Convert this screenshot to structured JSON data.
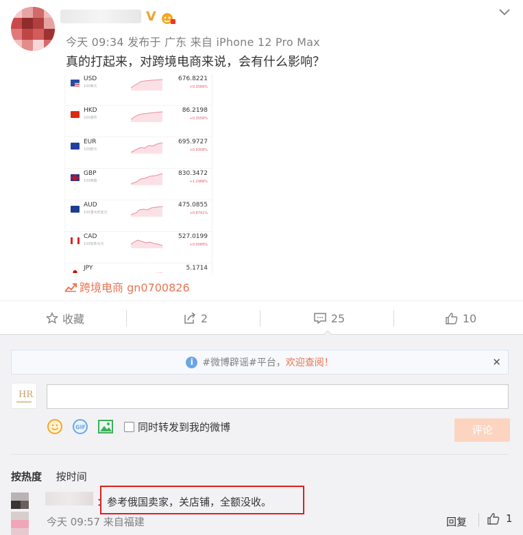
{
  "post": {
    "meta": "今天 09:34 发布于 广东 来自 iPhone 12 Pro Max",
    "text": "真的打起来，对跨境电商来说，会有什么影响？",
    "topic": "跨境电商 gn0700826",
    "vip_badge": "V"
  },
  "fx_rates": [
    {
      "code": "USD",
      "sub": "100美元",
      "value": "676.8221",
      "change": "+0.3566%",
      "flag": "us"
    },
    {
      "code": "HKD",
      "sub": "100港币",
      "value": "86.2198",
      "change": "+0.3556%",
      "flag": "hk"
    },
    {
      "code": "EUR",
      "sub": "100欧元",
      "value": "695.9727",
      "change": "+0.9308%",
      "flag": "eu"
    },
    {
      "code": "GBP",
      "sub": "100英镑",
      "value": "830.3472",
      "change": "+1.2988%",
      "flag": "gb"
    },
    {
      "code": "AUD",
      "sub": "100澳大利亚元",
      "value": "475.0855",
      "change": "+0.8741%",
      "flag": "au"
    },
    {
      "code": "CAD",
      "sub": "100加拿大元",
      "value": "527.0199",
      "change": "+0.0089%",
      "flag": "ca"
    },
    {
      "code": "JPY",
      "sub": "",
      "value": "5.1714",
      "change": "",
      "flag": "jp"
    }
  ],
  "actions": {
    "favorite": "收藏",
    "repost_count": "2",
    "comment_count": "25",
    "like_count": "10"
  },
  "comment_box": {
    "notice_prefix": "#微博辟谣#平台，",
    "notice_highlight": "欢迎查阅！",
    "repost_label": "同时转发到我的微博",
    "submit_label": "评论",
    "avatar_text": "HR"
  },
  "sort": {
    "hot": "按热度",
    "time": "按时间"
  },
  "comment": {
    "text": "：参考俄国卖家，关店铺，全额没收。",
    "meta": "今天 09:57 来自福建",
    "reply_label": "回复",
    "like_count": "1"
  },
  "colors": {
    "accent": "#eb7350",
    "link_blue": "#6aa6e4",
    "highlight_box": "#e01c1c"
  }
}
